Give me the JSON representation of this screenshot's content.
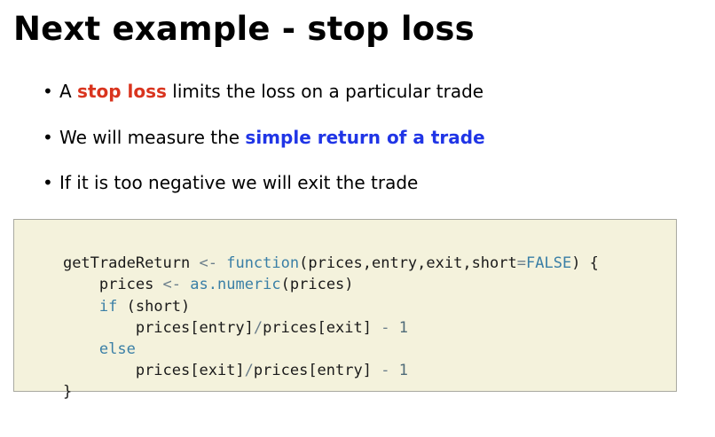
{
  "title": "Next example - stop loss",
  "bullets": [
    {
      "pre": "A ",
      "highlight": "stop loss",
      "post": " limits the loss on a particular trade"
    },
    {
      "pre": "We will measure the ",
      "highlight": "simple return of a trade",
      "post": ""
    },
    {
      "text": "If it is too negative we will exit the trade"
    }
  ],
  "bullet_symbol": "•",
  "colors": {
    "highlight_red": "#d9341e",
    "highlight_blue": "#2035e6",
    "code_background": "#f4f2dc",
    "code_border": "#a9a9a0",
    "keyword": "#3a7fa6"
  },
  "code": {
    "language": "R",
    "lines": [
      [
        {
          "t": "getTradeReturn ",
          "c": "plain"
        },
        {
          "t": "<-",
          "c": "op"
        },
        {
          "t": " ",
          "c": "plain"
        },
        {
          "t": "function",
          "c": "kw"
        },
        {
          "t": "(prices,entry,exit,short",
          "c": "plain"
        },
        {
          "t": "=",
          "c": "op"
        },
        {
          "t": "FALSE",
          "c": "kw"
        },
        {
          "t": ") {",
          "c": "plain"
        }
      ],
      [
        {
          "t": "    prices ",
          "c": "plain"
        },
        {
          "t": "<-",
          "c": "op"
        },
        {
          "t": " ",
          "c": "plain"
        },
        {
          "t": "as.numeric",
          "c": "kw"
        },
        {
          "t": "(prices)",
          "c": "plain"
        }
      ],
      [
        {
          "t": "    ",
          "c": "plain"
        },
        {
          "t": "if",
          "c": "kw"
        },
        {
          "t": " (short)",
          "c": "plain"
        }
      ],
      [
        {
          "t": "        prices[entry]",
          "c": "plain"
        },
        {
          "t": "/",
          "c": "op"
        },
        {
          "t": "prices[exit] ",
          "c": "plain"
        },
        {
          "t": "-",
          "c": "op"
        },
        {
          "t": " ",
          "c": "plain"
        },
        {
          "t": "1",
          "c": "num"
        }
      ],
      [
        {
          "t": "    ",
          "c": "plain"
        },
        {
          "t": "else",
          "c": "kw"
        }
      ],
      [
        {
          "t": "        prices[exit]",
          "c": "plain"
        },
        {
          "t": "/",
          "c": "op"
        },
        {
          "t": "prices[entry] ",
          "c": "plain"
        },
        {
          "t": "-",
          "c": "op"
        },
        {
          "t": " ",
          "c": "plain"
        },
        {
          "t": "1",
          "c": "num"
        }
      ],
      [
        {
          "t": "}",
          "c": "plain"
        }
      ]
    ]
  }
}
